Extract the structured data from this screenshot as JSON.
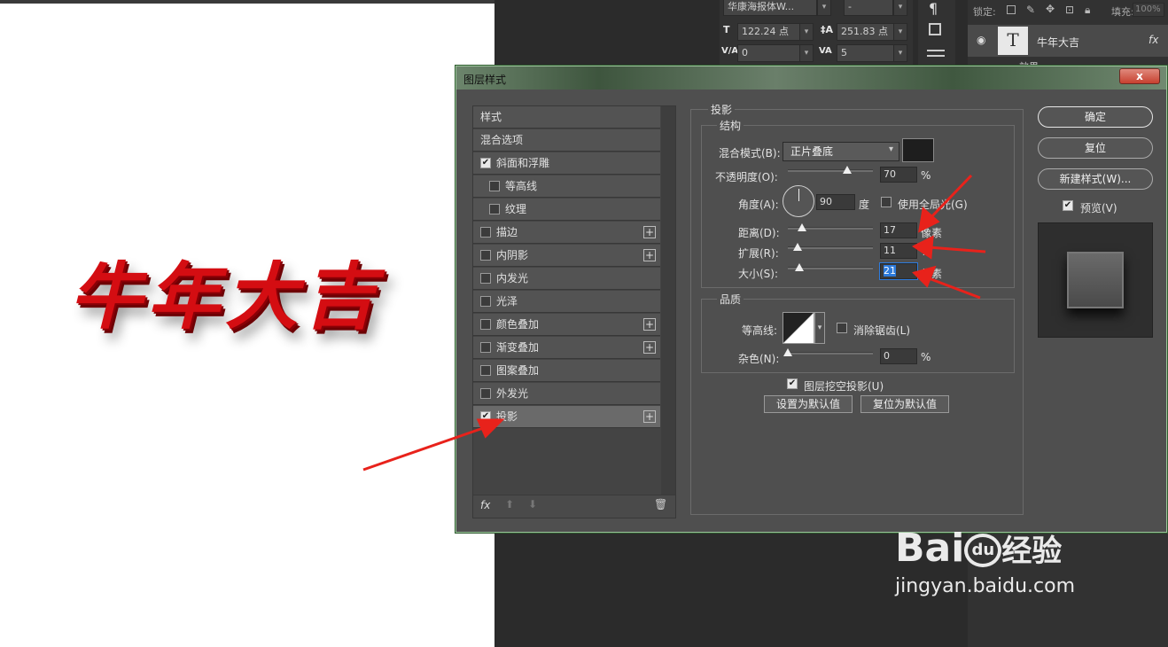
{
  "char_panel": {
    "font_family": "华康海报体W...",
    "font_style": "-",
    "font_size": "122.24 点",
    "leading": "251.83 点",
    "kerning": "0",
    "tracking": "5",
    "glyph_T": "T",
    "glyph_VA": "V/A",
    "glyph_VA2": "VA"
  },
  "layers_panel": {
    "lock_label": "锁定:",
    "fill_label": "填充:",
    "fill_value": "100%",
    "layer_name": "牛年大吉",
    "layer_glyph": "T",
    "fx_label": "fx",
    "effect_label": "效果"
  },
  "canvas": {
    "art_text": "牛年大吉"
  },
  "dialog": {
    "title": "图层样式",
    "close": "x",
    "styles": [
      {
        "label": "样式",
        "check": null,
        "plus": false
      },
      {
        "label": "混合选项",
        "check": null,
        "plus": false
      },
      {
        "label": "斜面和浮雕",
        "check": true,
        "plus": false
      },
      {
        "label": "等高线",
        "check": false,
        "plus": false,
        "indent": true
      },
      {
        "label": "纹理",
        "check": false,
        "plus": false,
        "indent": true
      },
      {
        "label": "描边",
        "check": false,
        "plus": true
      },
      {
        "label": "内阴影",
        "check": false,
        "plus": true
      },
      {
        "label": "内发光",
        "check": false,
        "plus": false
      },
      {
        "label": "光泽",
        "check": false,
        "plus": false
      },
      {
        "label": "颜色叠加",
        "check": false,
        "plus": true
      },
      {
        "label": "渐变叠加",
        "check": false,
        "plus": true
      },
      {
        "label": "图案叠加",
        "check": false,
        "plus": false
      },
      {
        "label": "外发光",
        "check": false,
        "plus": false
      },
      {
        "label": "投影",
        "check": true,
        "plus": true,
        "selected": true
      }
    ],
    "footer_fx": "fx",
    "section_title": "投影",
    "structure_title": "结构",
    "blend_mode_label": "混合模式(B):",
    "blend_mode_value": "正片叠底",
    "shadow_color": "#1e1e1e",
    "opacity_label": "不透明度(O):",
    "opacity_value": "70",
    "opacity_frac": 0.7,
    "percent": "%",
    "angle_label": "角度(A):",
    "angle_value": "90",
    "angle_unit": "度",
    "global_light_label": "使用全局光(G)",
    "distance_label": "距离(D):",
    "distance_value": "17",
    "distance_frac": 0.17,
    "spread_label": "扩展(R):",
    "spread_value": "11",
    "spread_frac": 0.11,
    "size_label": "大小(S):",
    "size_value": "21",
    "size_frac": 0.14,
    "pixel_unit": "像素",
    "quality_title": "品质",
    "contour_label": "等高线:",
    "anti_alias_label": "消除锯齿(L)",
    "noise_label": "杂色(N):",
    "noise_value": "0",
    "noise_frac": 0,
    "knockout_label": "图层挖空投影(U)",
    "set_default": "设置为默认值",
    "reset_default": "复位为默认值",
    "ok": "确定",
    "reset": "复位",
    "new_style": "新建样式(W)...",
    "preview_label": "预览(V)"
  },
  "watermark": {
    "brand": "Bai",
    "brand2": "du",
    "brand3": "经验",
    "url": "jingyan.baidu.com"
  },
  "colors": {
    "accent_arrow": "#e8221b",
    "dialog_bg": "#4f4f4f",
    "art_red": "#d40d12"
  }
}
